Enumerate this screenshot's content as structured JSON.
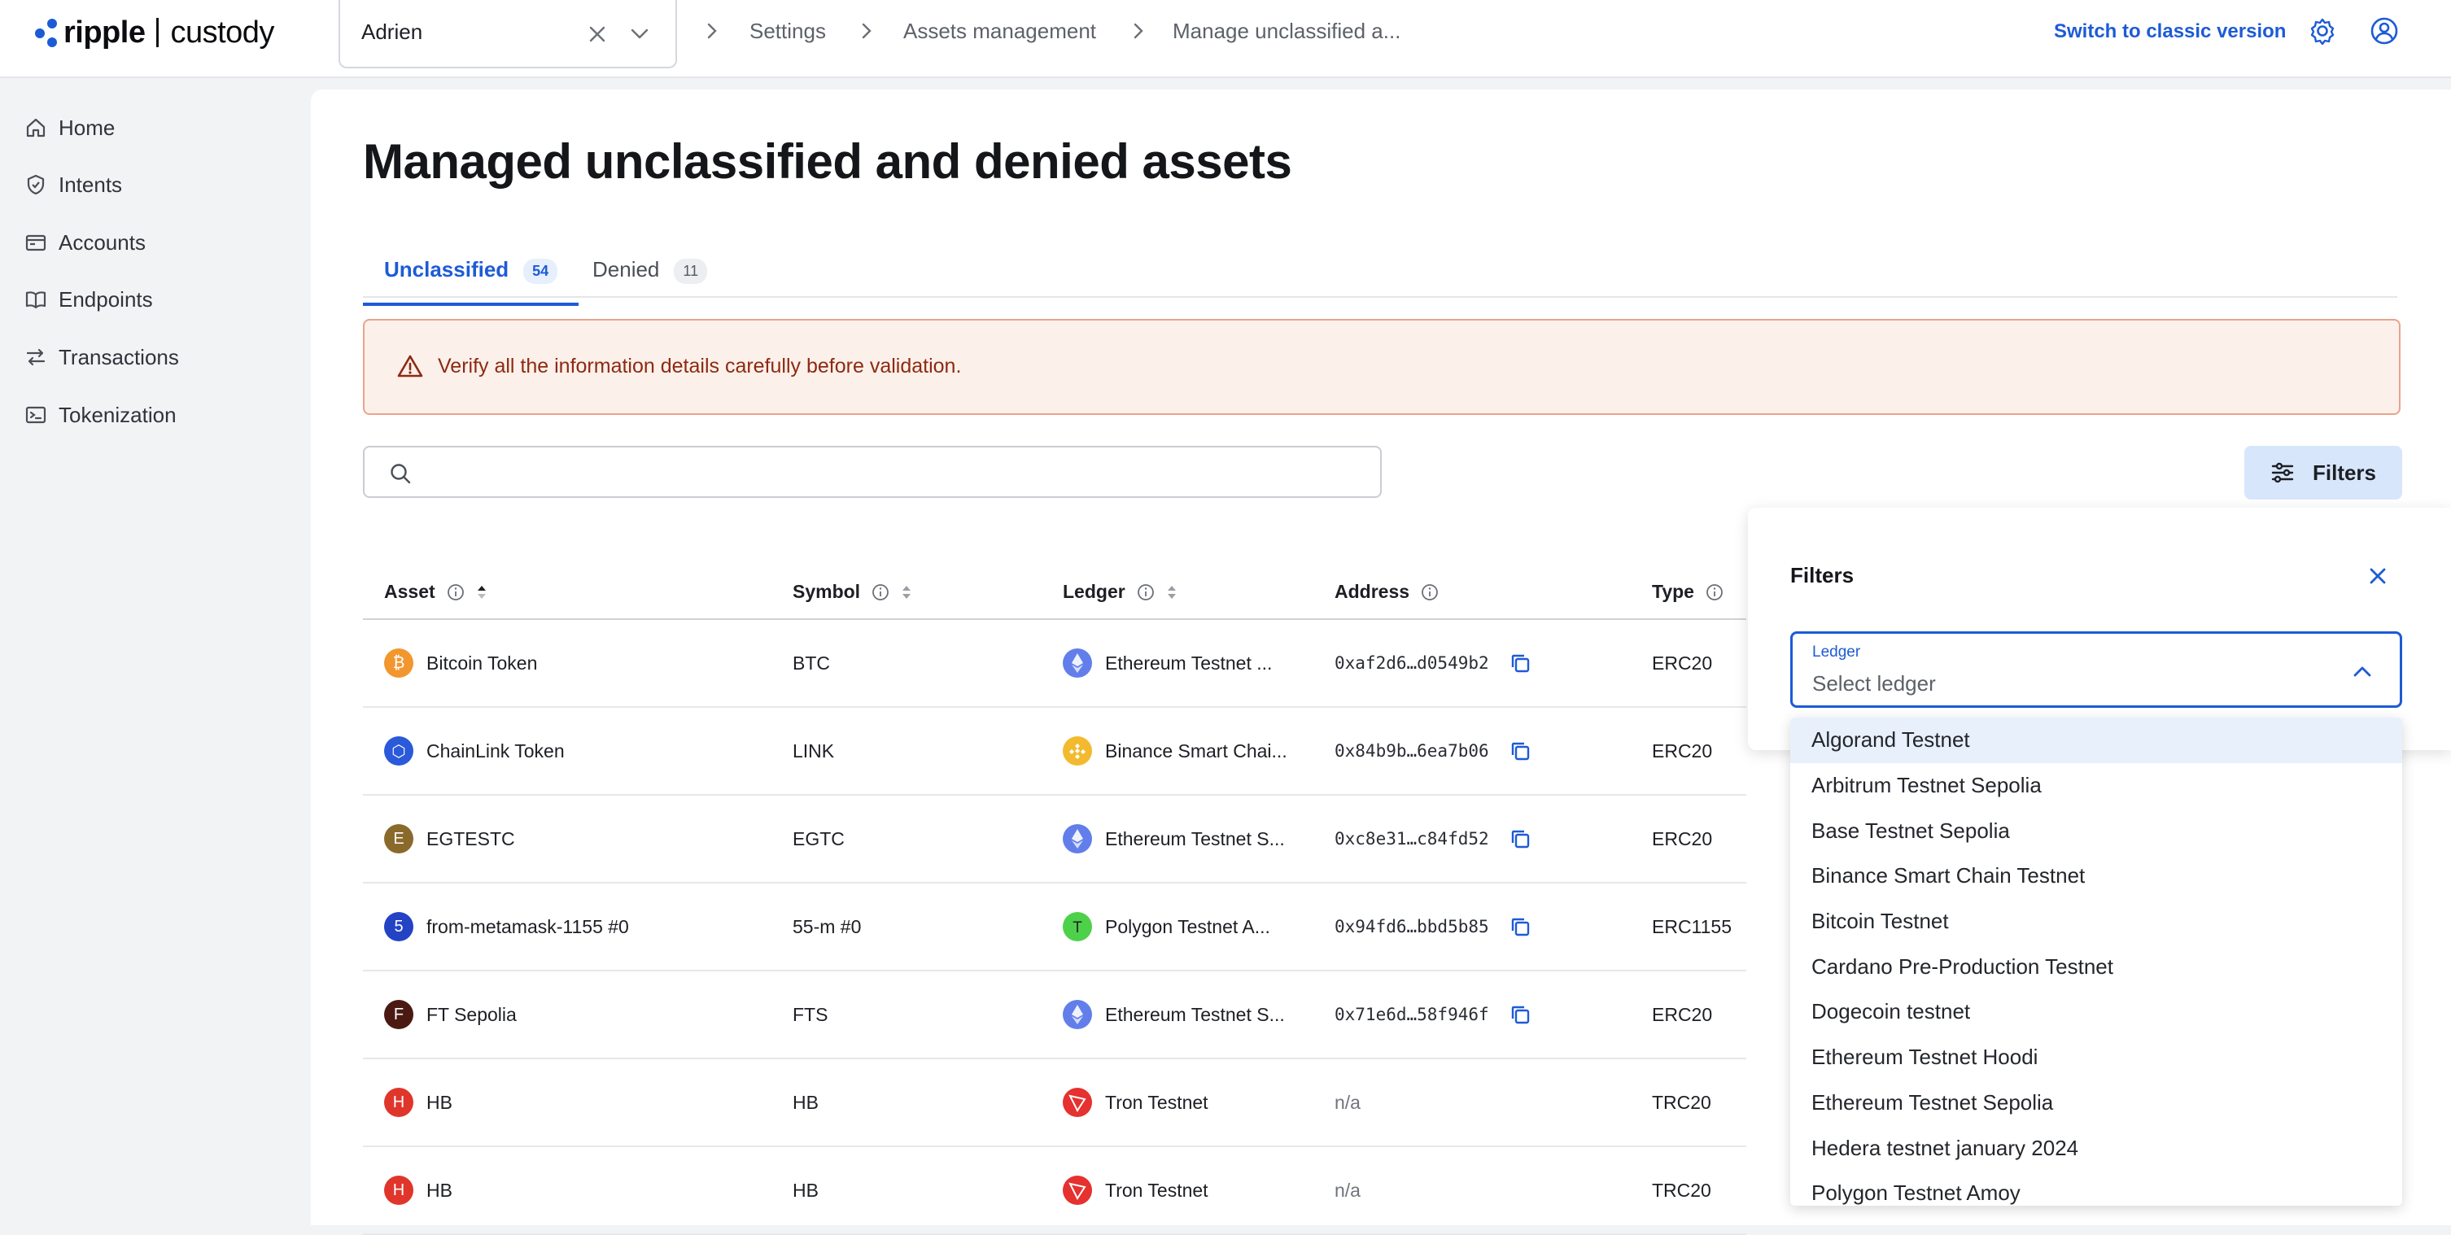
{
  "app": {
    "brand": "ripple",
    "product": "custody"
  },
  "org_select": {
    "value": "Adrien"
  },
  "breadcrumb": [
    "Settings",
    "Assets management",
    "Manage unclassified a..."
  ],
  "header": {
    "classic_link": "Switch to classic version"
  },
  "sidebar": {
    "items": [
      {
        "label": "Home",
        "icon": "home-icon"
      },
      {
        "label": "Intents",
        "icon": "shield-icon"
      },
      {
        "label": "Accounts",
        "icon": "wallet-icon"
      },
      {
        "label": "Endpoints",
        "icon": "book-icon"
      },
      {
        "label": "Transactions",
        "icon": "transfer-icon"
      },
      {
        "label": "Tokenization",
        "icon": "terminal-icon"
      }
    ]
  },
  "page": {
    "title": "Managed unclassified and denied assets"
  },
  "tabs": [
    {
      "label": "Unclassified",
      "count": "54",
      "active": true
    },
    {
      "label": "Denied",
      "count": "11",
      "active": false
    }
  ],
  "alert": {
    "message": "Verify all the information details carefully before validation."
  },
  "search": {
    "placeholder": ""
  },
  "filters_button": {
    "label": "Filters"
  },
  "table": {
    "columns": [
      "Asset",
      "Symbol",
      "Ledger",
      "Address",
      "Type"
    ],
    "rows": [
      {
        "asset": "Bitcoin Token",
        "avatar": "₿",
        "avatar_color": "#f2962e",
        "symbol": "BTC",
        "ledger": "Ethereum Testnet ...",
        "ledger_icon": "ethereum",
        "address": "0xaf2d6…d0549b2",
        "type": "ERC20"
      },
      {
        "asset": "ChainLink Token",
        "avatar": "⬡",
        "avatar_color": "#2a5ada",
        "symbol": "LINK",
        "ledger": "Binance Smart Chai...",
        "ledger_icon": "binance",
        "address": "0x84b9b…6ea7b06",
        "type": "ERC20"
      },
      {
        "asset": "EGTESTC",
        "avatar": "E",
        "avatar_color": "#8a6a2b",
        "symbol": "EGTC",
        "ledger": "Ethereum Testnet S...",
        "ledger_icon": "ethereum",
        "address": "0xc8e31…c84fd52",
        "type": "ERC20"
      },
      {
        "asset": "from-metamask-1155 #0",
        "avatar": "5",
        "avatar_color": "#2343c4",
        "symbol": "55-m #0",
        "ledger": "Polygon Testnet A...",
        "ledger_icon": "polygon",
        "address": "0x94fd6…bbd5b85",
        "type": "ERC1155"
      },
      {
        "asset": "FT Sepolia",
        "avatar": "F",
        "avatar_color": "#4a1a12",
        "symbol": "FTS",
        "ledger": "Ethereum Testnet S...",
        "ledger_icon": "ethereum",
        "address": "0x71e6d…58f946f",
        "type": "ERC20"
      },
      {
        "asset": "HB",
        "avatar": "H",
        "avatar_color": "#e0352b",
        "symbol": "HB",
        "ledger": "Tron Testnet",
        "ledger_icon": "tron",
        "address": "n/a",
        "type": "TRC20"
      },
      {
        "asset": "HB",
        "avatar": "H",
        "avatar_color": "#e0352b",
        "symbol": "HB",
        "ledger": "Tron Testnet",
        "ledger_icon": "tron",
        "address": "n/a",
        "type": "TRC20"
      }
    ]
  },
  "filters_panel": {
    "title": "Filters",
    "ledger_field": {
      "label": "Ledger",
      "placeholder": "Select ledger"
    },
    "options": [
      "Algorand Testnet",
      "Arbitrum Testnet Sepolia",
      "Base Testnet Sepolia",
      "Binance Smart Chain Testnet",
      "Bitcoin Testnet",
      "Cardano Pre-Production Testnet",
      "Dogecoin testnet",
      "Ethereum Testnet Hoodi",
      "Ethereum Testnet Sepolia",
      "Hedera testnet january 2024",
      "Polygon Testnet Amoy"
    ],
    "highlighted_option": "Algorand Testnet"
  },
  "colors": {
    "accent": "#1d5bd6",
    "alert_bg": "#fcf0ea",
    "alert_border": "#e9a48d",
    "alert_text": "#8d2a12"
  }
}
